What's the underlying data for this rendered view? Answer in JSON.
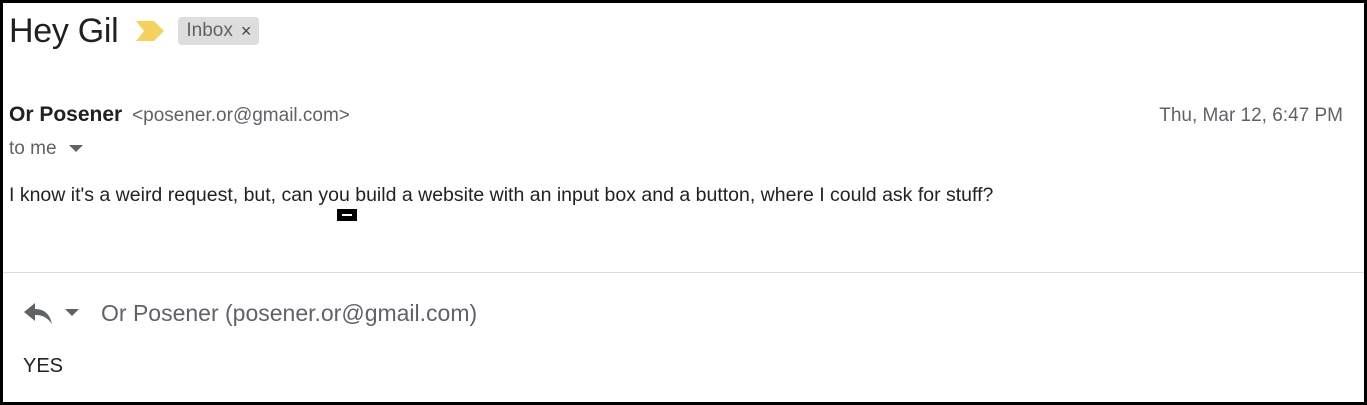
{
  "email": {
    "subject": "Hey Gil",
    "label": "Inbox",
    "label_close": "×",
    "sender_name": "Or Posener",
    "sender_email": "<posener.or@gmail.com>",
    "date": "Thu, Mar 12, 6:47 PM",
    "to": "to me",
    "body": "I know it's a weird request, but, can you build a website with an input box and a button, where I could ask for stuff?"
  },
  "reply": {
    "recipient": "Or Posener (posener.or@gmail.com)",
    "body": "YES"
  },
  "icons": {
    "importance": "importance-marker-icon",
    "reply": "reply-arrow-icon",
    "caret": "chevron-down-icon"
  },
  "colors": {
    "importance_marker": "#f4d25f",
    "label_bg": "#dddddd",
    "muted_text": "#5f6368"
  }
}
